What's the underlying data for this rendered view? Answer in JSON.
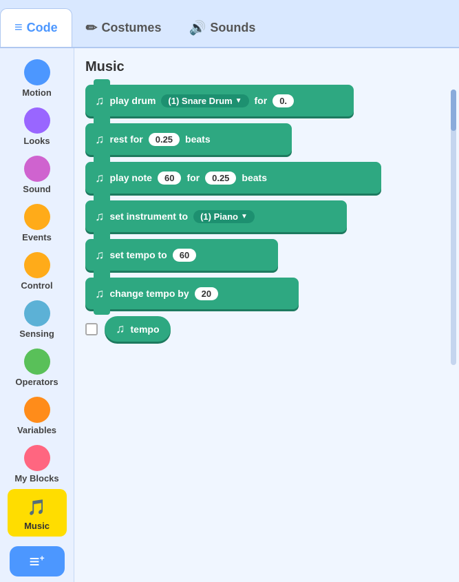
{
  "tabs": [
    {
      "id": "code",
      "label": "Code",
      "icon": "≡",
      "active": true
    },
    {
      "id": "costumes",
      "label": "Costumes",
      "icon": "✏️",
      "active": false
    },
    {
      "id": "sounds",
      "label": "Sounds",
      "icon": "🔊",
      "active": false
    }
  ],
  "sidebar": {
    "items": [
      {
        "id": "motion",
        "label": "Motion",
        "color": "motion"
      },
      {
        "id": "looks",
        "label": "Looks",
        "color": "looks"
      },
      {
        "id": "sound",
        "label": "Sound",
        "color": "sound"
      },
      {
        "id": "events",
        "label": "Events",
        "color": "events"
      },
      {
        "id": "control",
        "label": "Control",
        "color": "control"
      },
      {
        "id": "sensing",
        "label": "Sensing",
        "color": "sensing"
      },
      {
        "id": "operators",
        "label": "Operators",
        "color": "operators"
      },
      {
        "id": "variables",
        "label": "Variables",
        "color": "variables"
      },
      {
        "id": "myblocks",
        "label": "My Blocks",
        "color": "myblocks"
      }
    ],
    "active_extension": "music",
    "extension_label": "Music",
    "add_button_icon": "≡+"
  },
  "content": {
    "section_title": "Music",
    "blocks": [
      {
        "id": "play-drum",
        "text_before": "play drum",
        "dropdown": "(1) Snare Drum",
        "text_after": "for",
        "value": "0."
      },
      {
        "id": "rest-for",
        "text_before": "rest for",
        "value": "0.25",
        "text_after": "beats"
      },
      {
        "id": "play-note",
        "text_before": "play note",
        "value1": "60",
        "text_middle": "for",
        "value2": "0.25",
        "text_after": "beats"
      },
      {
        "id": "set-instrument",
        "text_before": "set instrument to",
        "dropdown": "(1) Piano"
      },
      {
        "id": "set-tempo",
        "text_before": "set tempo to",
        "value": "60"
      },
      {
        "id": "change-tempo",
        "text_before": "change tempo by",
        "value": "20"
      }
    ],
    "reporter": {
      "label": "tempo"
    }
  }
}
